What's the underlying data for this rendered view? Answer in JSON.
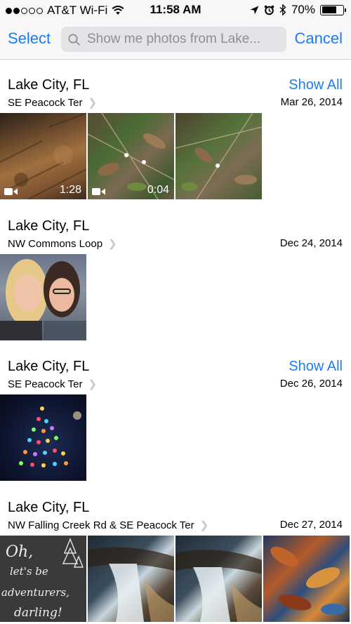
{
  "status": {
    "carrier": "AT&T Wi-Fi",
    "time": "11:58 AM",
    "battery": "70%",
    "battery_level": 0.7,
    "signal_bars_filled": 2,
    "signal_bars_total": 5
  },
  "nav": {
    "select_label": "Select",
    "search_text": "Show me photos from Lake...",
    "cancel_label": "Cancel"
  },
  "sections": [
    {
      "title": "Lake City, FL",
      "subtitle": "SE Peacock Ter",
      "date": "Mar 26, 2014",
      "show_all": "Show All",
      "durations": [
        "1:28",
        "0:04"
      ]
    },
    {
      "title": "Lake City, FL",
      "subtitle": "NW Commons Loop",
      "date": "Dec 24, 2014"
    },
    {
      "title": "Lake City, FL",
      "subtitle": "SE Peacock Ter",
      "date": "Dec 26, 2014",
      "show_all": "Show All"
    },
    {
      "title": "Lake City, FL",
      "subtitle": "NW Falling Creek Rd & SE Peacock Ter",
      "date": "Dec 27, 2014",
      "sign_text": [
        "Oh,",
        "let's be",
        "adventurers,",
        "darling!"
      ]
    }
  ],
  "colors": {
    "accent": "#1a7ef2",
    "secondary_text": "#8e8e93",
    "bar_background": "#f7f7f7"
  }
}
